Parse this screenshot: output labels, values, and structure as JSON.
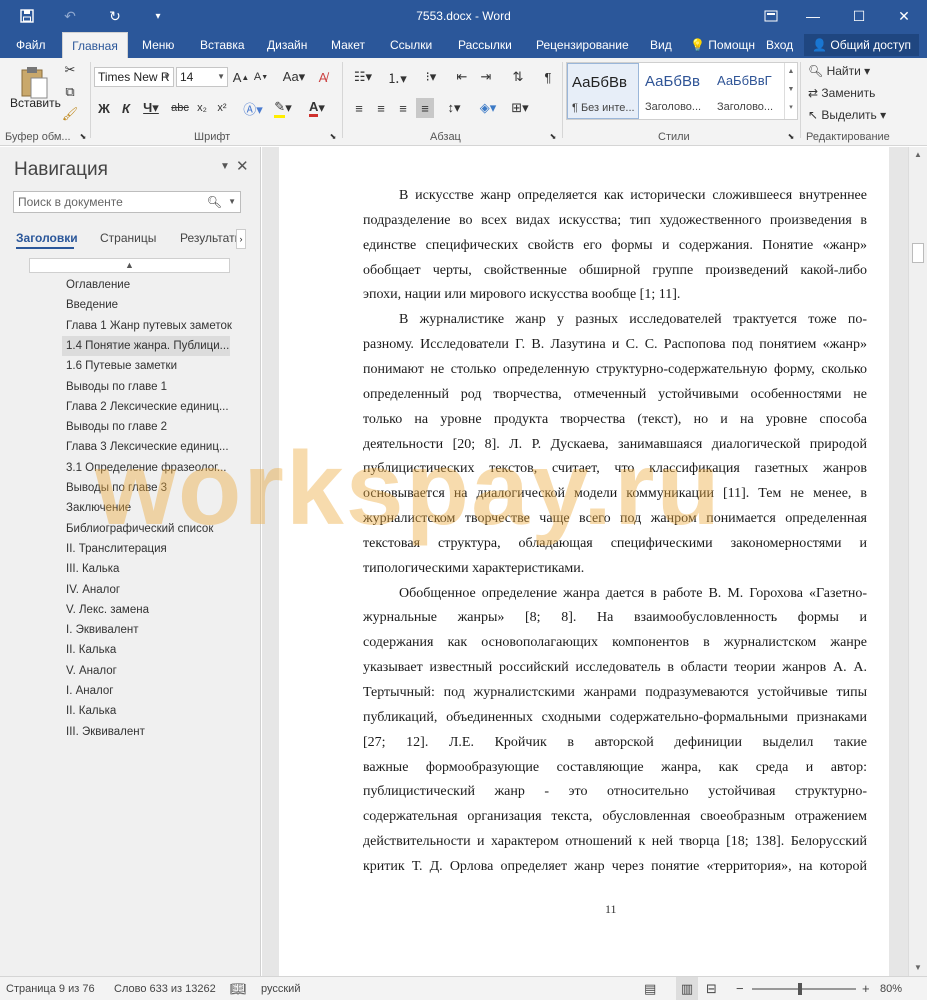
{
  "window": {
    "title": "7553.docx - Word"
  },
  "tabs": [
    {
      "label": "Файл",
      "active": false
    },
    {
      "label": "Главная",
      "active": true
    },
    {
      "label": "Меню",
      "active": false
    },
    {
      "label": "Вставка",
      "active": false
    },
    {
      "label": "Дизайн",
      "active": false
    },
    {
      "label": "Макет",
      "active": false
    },
    {
      "label": "Ссылки",
      "active": false
    },
    {
      "label": "Рассылки",
      "active": false
    },
    {
      "label": "Рецензирование",
      "active": false
    },
    {
      "label": "Вид",
      "active": false
    }
  ],
  "tellme": "Помощн",
  "signin": "Вход",
  "share": "Общий доступ",
  "ribbon": {
    "paste_label": "Вставить",
    "font_name": "Times New R",
    "font_size": "14",
    "groups": {
      "clipboard": "Буфер обм...",
      "font": "Шрифт",
      "paragraph": "Абзац",
      "styles": "Стили",
      "editing": "Редактирование"
    },
    "styles": [
      {
        "sample": "АаБбВв",
        "caption": "¶ Без инте..."
      },
      {
        "sample": "АаБбВв",
        "caption": "Заголово..."
      },
      {
        "sample": "АаБбВвГ",
        "caption": "Заголово..."
      }
    ],
    "editing": {
      "find": "Найти",
      "replace": "Заменить",
      "select": "Выделить"
    }
  },
  "nav": {
    "title": "Навигация",
    "search_placeholder": "Поиск в документе",
    "tabs": [
      "Заголовки",
      "Страницы",
      "Результаты"
    ],
    "headings": [
      "Оглавление",
      "Введение",
      "Глава 1 Жанр путевых заметок",
      "1.4 Понятие жанра. Публици...",
      "1.6 Путевые заметки",
      "Выводы по главе 1",
      "Глава 2 Лексические единиц...",
      "Выводы по главе 2",
      "Глава 3 Лексические единиц...",
      "3.1 Определение фразеолог...",
      "Выводы по главе 3",
      "Заключение",
      "Библиографический список",
      "II. Транслитерация",
      "III. Калька",
      "IV. Аналог",
      "V. Лекс. замена",
      "I. Эквивалент",
      "II. Калька",
      "V. Аналог",
      "I. Аналог",
      "II. Калька",
      "III. Эквивалент"
    ]
  },
  "document": {
    "lines": [
      "В искусстве жанр определяется как исторически сложившееся внутреннее",
      "подразделение во всех видах искусства; тип художественного произведения в",
      "единстве специфических свойств его формы и содержания. Понятие «жанр»",
      "обобщает черты, свойственные обширной группе произведений какой-либо",
      "эпохи, нации или мирового искусства вообще [1; 11].",
      "В журналистике жанр у разных исследователей трактуется тоже по-",
      "разному. Исследователи Г. В. Лазутина и С. С. Распопова под понятием «жанр»",
      "понимают не столько определенную структурно-содержательную форму, сколько",
      "определенный род творчества, отмеченный устойчивыми особенностями не",
      "только на уровне продукта творчества (текст), но и на уровне способа",
      "деятельности [20; 8]. Л. Р. Дускаева, занимавшаяся диалогической природой",
      "публицистических текстов, считает, что классификация газетных жанров",
      "основывается на диалогической модели коммуникации [11]. Тем не менее, в",
      "журналистском творчестве чаще всего под жанром понимается определенная",
      "текстовая структура, обладающая специфическими закономерностями и",
      "типологическими характеристиками.",
      "Обобщенное определение жанра дается в работе В. М. Горохова «Газетно-",
      "журнальные жанры» [8;                    8]. На взаимообусловленность формы и",
      "содержания как основополагающих компонентов в журналистском жанре",
      "указывает известный российский исследователь в области теории жанров А. А.",
      "Тертычный: под журналистскими жанрами подразумеваются устойчивые типы",
      "публикаций, объединенных сходными содержательно-формальными признаками",
      "[27;                          12]. Л.Е. Кройчик в авторской дефиниции выделил такие",
      "важные формообразующие составляющие жанра, как среда и автор:",
      "публицистический жанр - это относительно устойчивая структурно-",
      "содержательная организация текста, обусловленная своеобразным отражением",
      "действительности и характером отношений к ней творца [18; 138]. Белорусский",
      "критик Т. Д. Орлова определяет жанр через понятие «территория», на которой"
    ],
    "page_number": "11"
  },
  "watermark": "workspay.ru",
  "status": {
    "page": "Страница 9 из 76",
    "words": "Слово 633 из 13262",
    "language": "русский",
    "zoom": "80%"
  }
}
